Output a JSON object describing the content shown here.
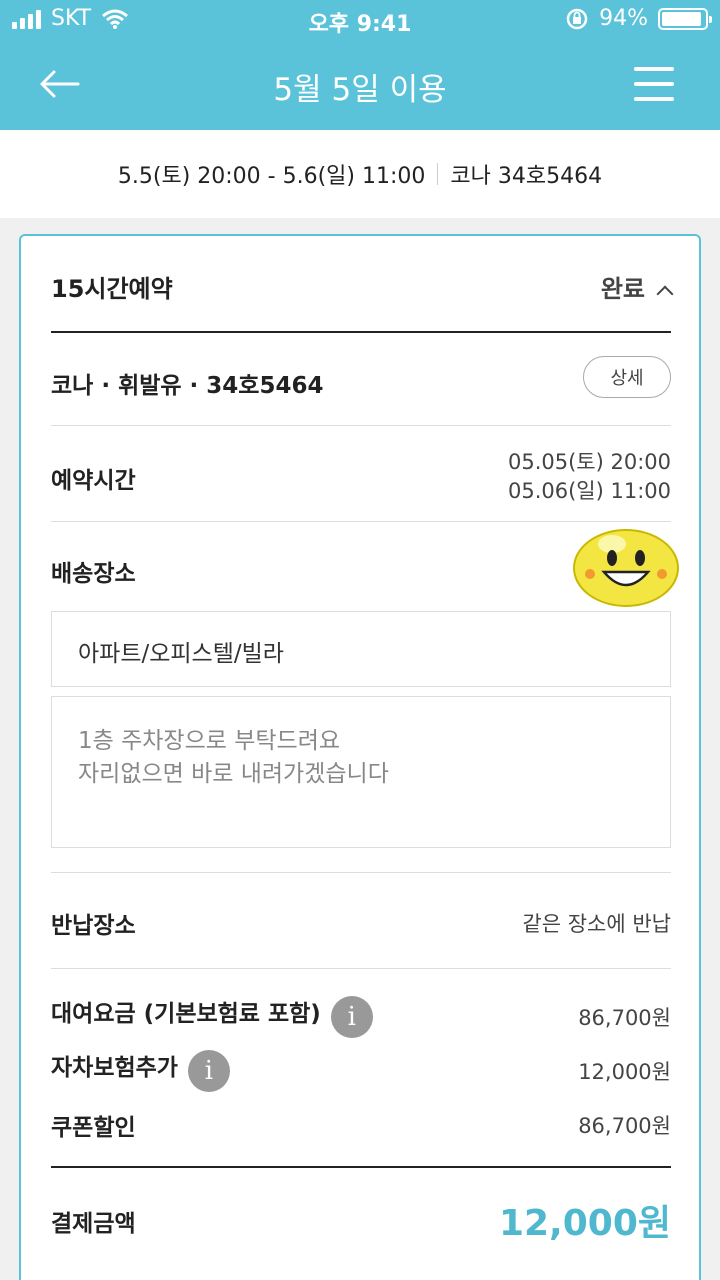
{
  "status_bar": {
    "carrier": "SKT",
    "time": "오후 9:41",
    "battery_pct": "94%",
    "battery_level": 0.94,
    "icons": [
      "signal-icon",
      "wifi-icon",
      "rotation-lock-icon",
      "battery-icon"
    ]
  },
  "header": {
    "title": "5월 5일 이용",
    "back_icon": "back-arrow-icon",
    "menu_icon": "hamburger-menu-icon",
    "background": "#5bc3d9"
  },
  "summary": {
    "period": "5.5(토) 20:00 - 5.6(일) 11:00",
    "car": "코나 34호5464"
  },
  "reservation": {
    "title": "15시간예약",
    "status": "완료",
    "car_info": "코나 · 휘발유 · 34호5464",
    "detail_button": "상세",
    "time_label": "예약시간",
    "time_start": "05.05(토) 20:00",
    "time_end": "05.06(일) 11:00",
    "delivery_label": "배송장소",
    "delivery_type": "아파트/오피스텔/빌라",
    "memo_line1": "1층 주차장으로 부탁드려요",
    "memo_line2": "자리없으면 바로 내려가겠습니다",
    "return_label": "반납장소",
    "return_value": "같은 장소에 반납"
  },
  "charges": {
    "rental_label": "대여요금 (기본보험료 포함)",
    "rental_value": "86,700원",
    "insurance_label": "자차보험추가",
    "insurance_value": "12,000원",
    "coupon_label": "쿠폰할인",
    "coupon_value": "86,700원",
    "total_label": "결제금액",
    "total_value": "12,000원",
    "accent": "#4fb8cf"
  }
}
